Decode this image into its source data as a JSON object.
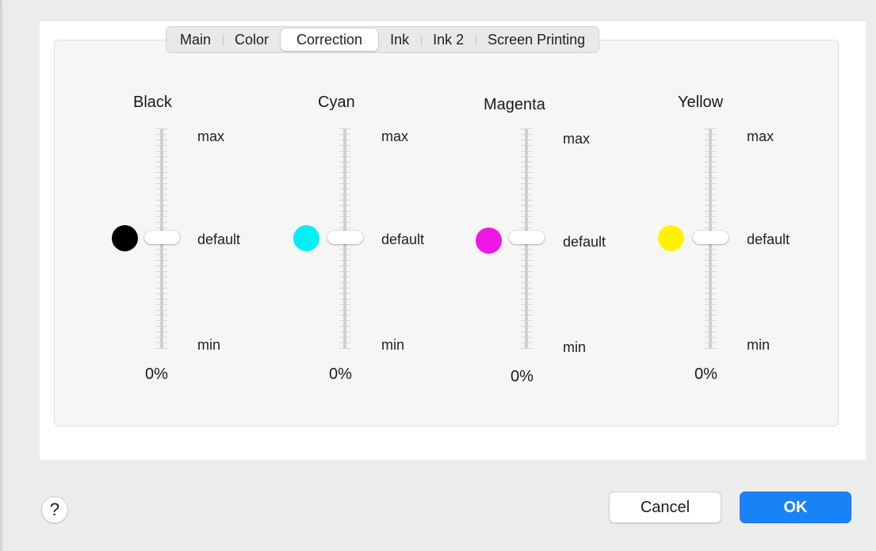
{
  "tabs": [
    {
      "label": "Main",
      "active": false
    },
    {
      "label": "Color",
      "active": false
    },
    {
      "label": "Correction",
      "active": true
    },
    {
      "label": "Ink",
      "active": false
    },
    {
      "label": "Ink 2",
      "active": false
    },
    {
      "label": "Screen Printing",
      "active": false
    }
  ],
  "inks": [
    {
      "name": "Black",
      "color": "#000000",
      "max_label": "max",
      "default_label": "default",
      "min_label": "min",
      "value": "0%",
      "level": 0.5
    },
    {
      "name": "Cyan",
      "color": "#00f0f5",
      "max_label": "max",
      "default_label": "default",
      "min_label": "min",
      "value": "0%",
      "level": 0.5
    },
    {
      "name": "Magenta",
      "color": "#f016e6",
      "max_label": "max",
      "default_label": "default",
      "min_label": "min",
      "value": "0%",
      "level": 0.5
    },
    {
      "name": "Yellow",
      "color": "#fff300",
      "max_label": "max",
      "default_label": "default",
      "min_label": "min",
      "value": "0%",
      "level": 0.5
    }
  ],
  "footer": {
    "help_label": "?",
    "cancel_label": "Cancel",
    "ok_label": "OK"
  },
  "colors": {
    "accent": "#1a82f7"
  }
}
